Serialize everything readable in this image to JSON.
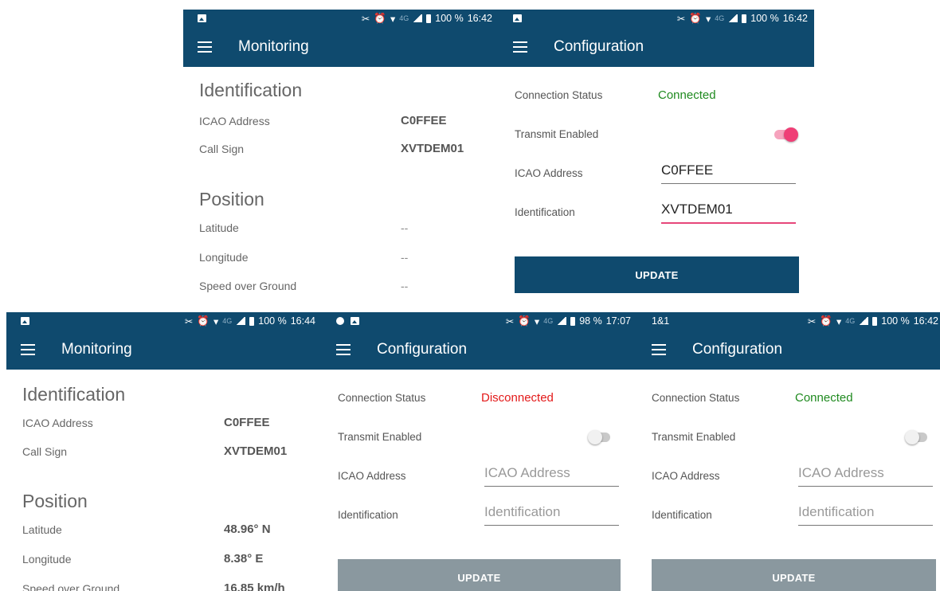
{
  "screens": {
    "mon_top": {
      "status": {
        "time": "16:42",
        "battery": "100 %",
        "network": "4G"
      },
      "title": "Monitoring",
      "identification": {
        "heading": "Identification",
        "icao_label": "ICAO Address",
        "icao_value": "C0FFEE",
        "callsign_label": "Call Sign",
        "callsign_value": "XVTDEM01"
      },
      "position": {
        "heading": "Position",
        "lat_label": "Latitude",
        "lat_value": "--",
        "lon_label": "Longitude",
        "lon_value": "--",
        "sog_label": "Speed over Ground",
        "sog_value": "--"
      }
    },
    "cfg_top": {
      "status": {
        "time": "16:42",
        "battery": "100 %",
        "network": "4G"
      },
      "title": "Configuration",
      "connection_label": "Connection Status",
      "connection_value": "Connected",
      "transmit_label": "Transmit Enabled",
      "icao_label": "ICAO Address",
      "icao_value": "C0FFEE",
      "icao_placeholder": "ICAO Address",
      "ident_label": "Identification",
      "ident_value": "XVTDEM01",
      "ident_placeholder": "Identification",
      "update_label": "UPDATE"
    },
    "mon_bottom": {
      "status": {
        "time": "16:44",
        "battery": "100 %",
        "network": "4G"
      },
      "title": "Monitoring",
      "identification": {
        "heading": "Identification",
        "icao_label": "ICAO Address",
        "icao_value": "C0FFEE",
        "callsign_label": "Call Sign",
        "callsign_value": "XVTDEM01"
      },
      "position": {
        "heading": "Position",
        "lat_label": "Latitude",
        "lat_value": "48.96° N",
        "lon_label": "Longitude",
        "lon_value": "8.38° E",
        "sog_label": "Speed over Ground",
        "sog_value": "16.85 km/h"
      }
    },
    "cfg_mid": {
      "status": {
        "time": "17:07",
        "battery": "98 %",
        "network": "4G"
      },
      "title": "Configuration",
      "connection_label": "Connection Status",
      "connection_value": "Disconnected",
      "transmit_label": "Transmit Enabled",
      "icao_label": "ICAO Address",
      "icao_value": "",
      "icao_placeholder": "ICAO Address",
      "ident_label": "Identification",
      "ident_value": "",
      "ident_placeholder": "Identification",
      "update_label": "UPDATE"
    },
    "cfg_right": {
      "status": {
        "time": "16:42",
        "battery": "100 %",
        "network": "4G",
        "left_text": "1&1"
      },
      "title": "Configuration",
      "connection_label": "Connection Status",
      "connection_value": "Connected",
      "transmit_label": "Transmit Enabled",
      "icao_label": "ICAO Address",
      "icao_value": "",
      "icao_placeholder": "ICAO Address",
      "ident_label": "Identification",
      "ident_value": "",
      "ident_placeholder": "Identification",
      "update_label": "UPDATE"
    }
  },
  "colors": {
    "primary": "#0f4a6e",
    "connected": "#1f8a1f",
    "disconnected": "#e31919",
    "accent": "#ef3e76",
    "disabled_button": "#8a989f"
  }
}
